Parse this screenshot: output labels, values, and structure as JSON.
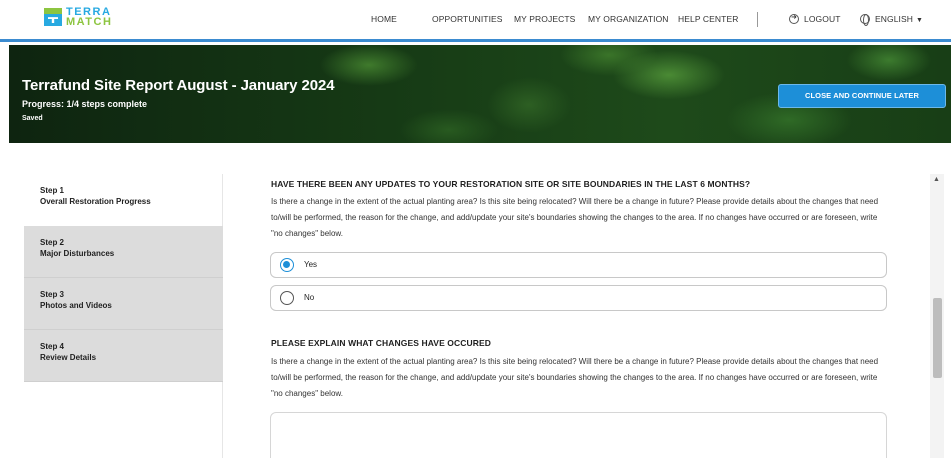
{
  "brand": {
    "line1": "TERRA",
    "line2": "MATCH"
  },
  "nav": {
    "home": "HOME",
    "opportunities": "OPPORTUNITIES",
    "my_projects": "MY PROJECTS",
    "my_organization": "MY ORGANIZATION",
    "help_center": "HELP CENTER",
    "logout": "LOGOUT",
    "language": "ENGLISH"
  },
  "header": {
    "title": "Terrafund Site Report August - January 2024",
    "progress": "Progress: 1/4 steps complete",
    "saved": "Saved",
    "close_button": "CLOSE AND CONTINUE LATER"
  },
  "steps": [
    {
      "num": "Step 1",
      "name": "Overall Restoration Progress",
      "active": true
    },
    {
      "num": "Step 2",
      "name": "Major Disturbances",
      "active": false
    },
    {
      "num": "Step 3",
      "name": "Photos and Videos",
      "active": false
    },
    {
      "num": "Step 4",
      "name": "Review Details",
      "active": false
    }
  ],
  "questions": [
    {
      "title": "HAVE THERE BEEN ANY UPDATES TO YOUR RESTORATION SITE OR SITE BOUNDARIES IN THE LAST 6 MONTHS?",
      "description": "Is there a change in the extent of the actual planting area? Is this site being relocated? Will there be a change in future? Please provide details about the changes that need to/will be performed, the reason for the change, and add/update your site's boundaries showing the changes to the area. If no changes have occurred or are foreseen, write \"no changes\" below.",
      "options": [
        {
          "label": "Yes",
          "selected": true
        },
        {
          "label": "No",
          "selected": false
        }
      ]
    },
    {
      "title": "PLEASE EXPLAIN WHAT CHANGES HAVE OCCURED",
      "description": "Is there a change in the extent of the actual planting area? Is this site being relocated? Will there be a change in future? Please provide details about the changes that need to/will be performed, the reason for the change, and add/update your site's boundaries showing the changes to the area. If no changes have occurred or are foreseen, write \"no changes\" below.",
      "answer": ""
    }
  ],
  "colors": {
    "accent": "#1d8fd8",
    "brand_blue": "#27a9e1",
    "brand_green": "#8dc540"
  }
}
